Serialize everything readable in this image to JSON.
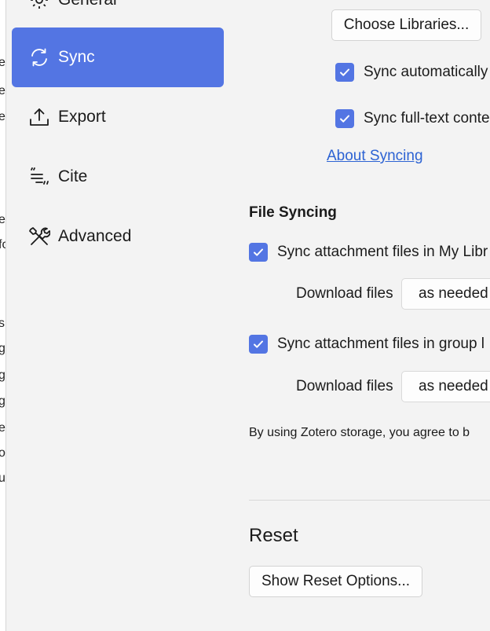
{
  "background_window": {
    "fragments": [
      "e",
      "e",
      "e",
      "",
      "ea",
      "fo",
      "s",
      "g",
      "g",
      "g",
      "e",
      "o",
      "u"
    ]
  },
  "sidebar": {
    "items": [
      {
        "label": "General",
        "icon": "gear-icon"
      },
      {
        "label": "Sync",
        "icon": "sync-icon",
        "active": true
      },
      {
        "label": "Export",
        "icon": "export-icon"
      },
      {
        "label": "Cite",
        "icon": "cite-icon"
      },
      {
        "label": "Advanced",
        "icon": "tools-icon"
      }
    ]
  },
  "sync": {
    "choose_libraries_label": "Choose Libraries...",
    "sync_automatically_label": "Sync automatically",
    "sync_fulltext_label": "Sync full-text conte",
    "about_syncing_label": "About Syncing"
  },
  "file_syncing": {
    "heading": "File Syncing",
    "my_library_label": "Sync attachment files in My Libr",
    "my_library_download_label": "Download files",
    "my_library_download_value": "as needed",
    "group_label": "Sync attachment files in group l",
    "group_download_label": "Download files",
    "group_download_value": "as needed",
    "storage_note": "By using Zotero storage, you agree to b"
  },
  "reset": {
    "title": "Reset",
    "button_label": "Show Reset Options..."
  },
  "colors": {
    "accent": "#5375e3",
    "link": "#2d63d3",
    "background": "#f3f3f3"
  }
}
